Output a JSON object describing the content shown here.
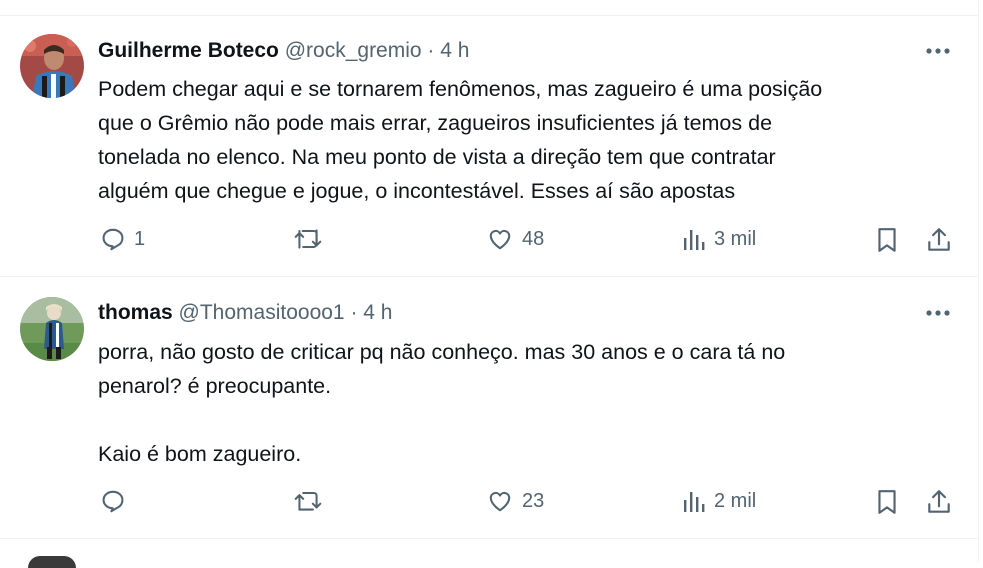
{
  "tweets": [
    {
      "author_name": "Guilherme Boteco",
      "handle": "@rock_gremio",
      "separator": "·",
      "time": "4 h",
      "text": "Podem chegar aqui e se tornarem fenômenos, mas zagueiro é uma posição\nque o Grêmio não pode mais errar, zagueiros insuficientes já temos de\ntonelada no elenco. Na meu ponto de vista a direção tem que contratar\nalguém que chegue e jogue, o incontestável. Esses aí são apostas",
      "replies": "1",
      "reposts": "",
      "likes": "48",
      "views": "3 mil"
    },
    {
      "author_name": "thomas",
      "handle": "@Thomasitoooo1",
      "separator": "·",
      "time": "4 h",
      "text": "porra, não gosto de criticar pq não conheço. mas 30 anos e o cara tá no\npenarol? é preocupante.\n\nKaio é bom zagueiro.",
      "replies": "",
      "reposts": "",
      "likes": "23",
      "views": "2 mil"
    }
  ],
  "icons": {
    "reply": "speech-bubble-icon",
    "repost": "repost-arrows-icon",
    "like": "heart-icon",
    "views": "bar-chart-icon",
    "bookmark": "bookmark-icon",
    "share": "share-upload-icon",
    "more": "more-dots-icon"
  },
  "colors": {
    "text": "#0f1419",
    "muted": "#536471",
    "divider": "#eff3f4"
  }
}
